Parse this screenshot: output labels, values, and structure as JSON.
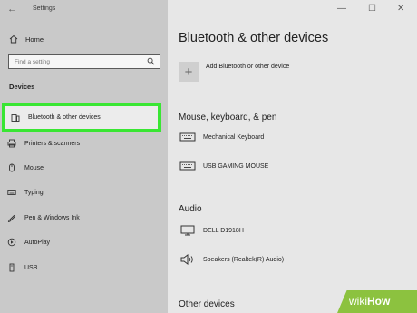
{
  "titlebar": {
    "title": "Settings",
    "back_icon": "←",
    "minimize": "—",
    "maximize": "☐",
    "close": "✕"
  },
  "sidebar": {
    "home_label": "Home",
    "search_placeholder": "Find a setting",
    "section_label": "Devices",
    "items": [
      {
        "label": "Bluetooth & other devices",
        "icon": "bluetooth-devices-icon",
        "selected": true
      },
      {
        "label": "Printers & scanners",
        "icon": "printer-icon"
      },
      {
        "label": "Mouse",
        "icon": "mouse-icon"
      },
      {
        "label": "Typing",
        "icon": "keyboard-icon"
      },
      {
        "label": "Pen & Windows Ink",
        "icon": "pen-icon"
      },
      {
        "label": "AutoPlay",
        "icon": "autoplay-icon"
      },
      {
        "label": "USB",
        "icon": "usb-icon"
      }
    ]
  },
  "main": {
    "title": "Bluetooth & other devices",
    "add_button_icon": "+",
    "add_label": "Add Bluetooth or other device",
    "sections": [
      {
        "heading": "Mouse, keyboard, & pen",
        "devices": [
          {
            "name": "Mechanical Keyboard",
            "icon": "keyboard-icon"
          },
          {
            "name": "USB GAMING MOUSE",
            "icon": "keyboard-icon"
          }
        ]
      },
      {
        "heading": "Audio",
        "devices": [
          {
            "name": "DELL D1918H",
            "icon": "monitor-icon"
          },
          {
            "name": "Speakers (Realtek(R) Audio)",
            "icon": "speaker-icon"
          }
        ]
      },
      {
        "heading": "Other devices",
        "devices": []
      }
    ]
  },
  "watermark": {
    "prefix": "wiki",
    "suffix": "How"
  },
  "colors": {
    "sidebar_bg": "#c9c9c9",
    "main_bg": "#e7e7e7",
    "highlight": "#39e633",
    "watermark": "#8cc23f"
  }
}
